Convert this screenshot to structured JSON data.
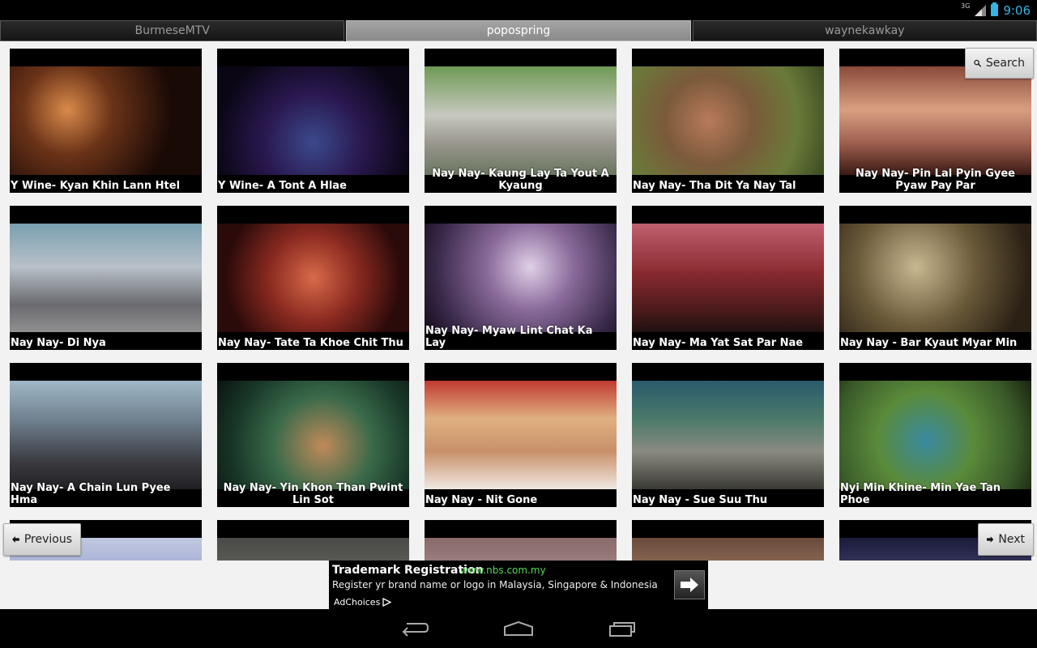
{
  "status": {
    "time": "9:06",
    "network": "3G"
  },
  "tabs": [
    {
      "label": "BurmeseMTV",
      "active": false
    },
    {
      "label": "popospring",
      "active": true
    },
    {
      "label": "waynekawkay",
      "active": false
    }
  ],
  "search_label": "Search",
  "previous_label": "Previous",
  "next_label": "Next",
  "videos": [
    {
      "title": "Y Wine- Kyan Khin Lann Htel"
    },
    {
      "title": "Y Wine- A Tont A Hlae"
    },
    {
      "title": "Nay Nay- Kaung Lay Ta Yout A Kyaung"
    },
    {
      "title": "Nay Nay- Tha Dit Ya Nay Tal"
    },
    {
      "title": "Nay Nay- Pin Lal Pyin Gyee Pyaw Pay Par"
    },
    {
      "title": "Nay Nay- Di Nya"
    },
    {
      "title": "Nay Nay- Tate Ta Khoe Chit Thu"
    },
    {
      "title": "Nay Nay- Myaw Lint Chat Ka Lay"
    },
    {
      "title": "Nay Nay- Ma Yat Sat Par Nae"
    },
    {
      "title": "Nay Nay - Bar Kyaut Myar Min"
    },
    {
      "title": "Nay Nay- A Chain Lun Pyee Hma"
    },
    {
      "title": "Nay Nay- Yin Khon Than Pwint Lin Sot"
    },
    {
      "title": "Nay Nay - Nit Gone"
    },
    {
      "title": "Nay Nay - Sue Suu Thu"
    },
    {
      "title": "Nyi Min Khine- Min Yae Tan Phoe"
    },
    {
      "title": ""
    },
    {
      "title": ""
    },
    {
      "title": ""
    },
    {
      "title": ""
    },
    {
      "title": ""
    }
  ],
  "ad": {
    "title": "Trademark Registration",
    "url": "www.nbs.com.my",
    "text": "Register yr brand name or logo in Malaysia, Singapore & Indonesia",
    "choices": "AdChoices"
  },
  "colors": {
    "accent": "#33b5e5",
    "ad_url": "#5cd65c"
  }
}
